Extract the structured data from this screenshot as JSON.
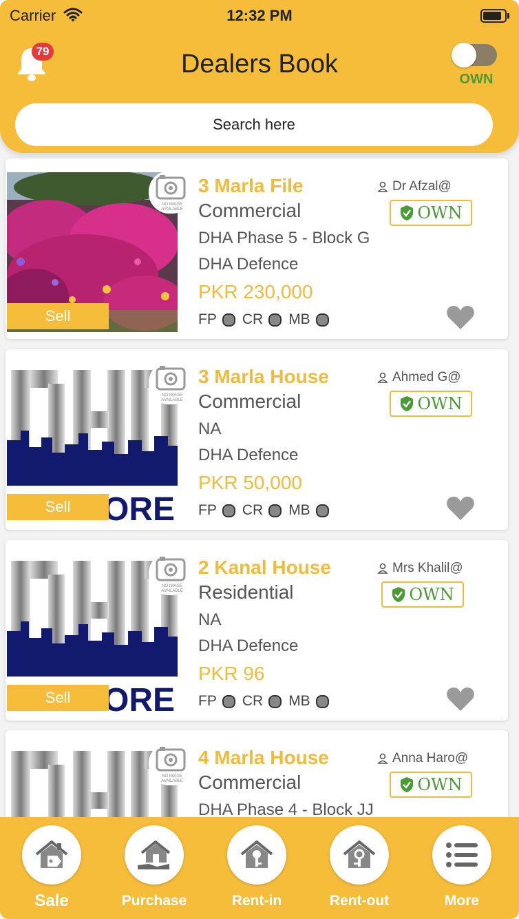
{
  "status": {
    "carrier": "Carrier",
    "time": "12:32 PM"
  },
  "header": {
    "title": "Dealers Book",
    "notification_count": "79",
    "toggle_label": "OWN",
    "search_placeholder": "Search here"
  },
  "listings": [
    {
      "title": "3 Marla File",
      "type": "Commercial",
      "address": "DHA Phase 5 - Block G",
      "area": "DHA Defence",
      "price": "PKR 230,000",
      "dealer": "Dr Afzal@",
      "own_label": "OWN",
      "sell_label": "Sell",
      "chips": [
        "FP",
        "CR",
        "MB"
      ],
      "image": "flowers-photo"
    },
    {
      "title": "3 Marla House",
      "type": "Commercial",
      "address": "NA",
      "area": "DHA Defence",
      "price": "PKR 50,000",
      "dealer": "Ahmed G@",
      "own_label": "OWN",
      "sell_label": "Sell",
      "chips": [
        "FP",
        "CR",
        "MB"
      ],
      "image": "dha-lahore-logo"
    },
    {
      "title": "2 Kanal House",
      "type": "Residential",
      "address": "NA",
      "area": "DHA Defence",
      "price": "PKR 96",
      "dealer": "Mrs Khalil@",
      "own_label": "OWN",
      "sell_label": "Sell",
      "chips": [
        "FP",
        "CR",
        "MB"
      ],
      "image": "dha-lahore-logo"
    },
    {
      "title": "4 Marla House",
      "type": "Commercial",
      "address": "DHA Phase 4 - Block JJ",
      "area": "",
      "price": "",
      "dealer": "Anna Haro@",
      "own_label": "OWN",
      "sell_label": "",
      "chips": [],
      "image": "dha-lahore-logo"
    }
  ],
  "no_image_text": "NO IMAGE AVAILABLE",
  "tabs": [
    {
      "label": "Sale",
      "icon": "house-tag-icon",
      "active": true
    },
    {
      "label": "Purchase",
      "icon": "house-hand-icon",
      "active": false
    },
    {
      "label": "Rent-in",
      "icon": "house-key-in-icon",
      "active": false
    },
    {
      "label": "Rent-out",
      "icon": "house-key-out-icon",
      "active": false
    },
    {
      "label": "More",
      "icon": "list-icon",
      "active": false
    }
  ],
  "colors": {
    "accent": "#f5bd3a",
    "own_green": "#4a9a35",
    "badge_red": "#e33b3b"
  }
}
